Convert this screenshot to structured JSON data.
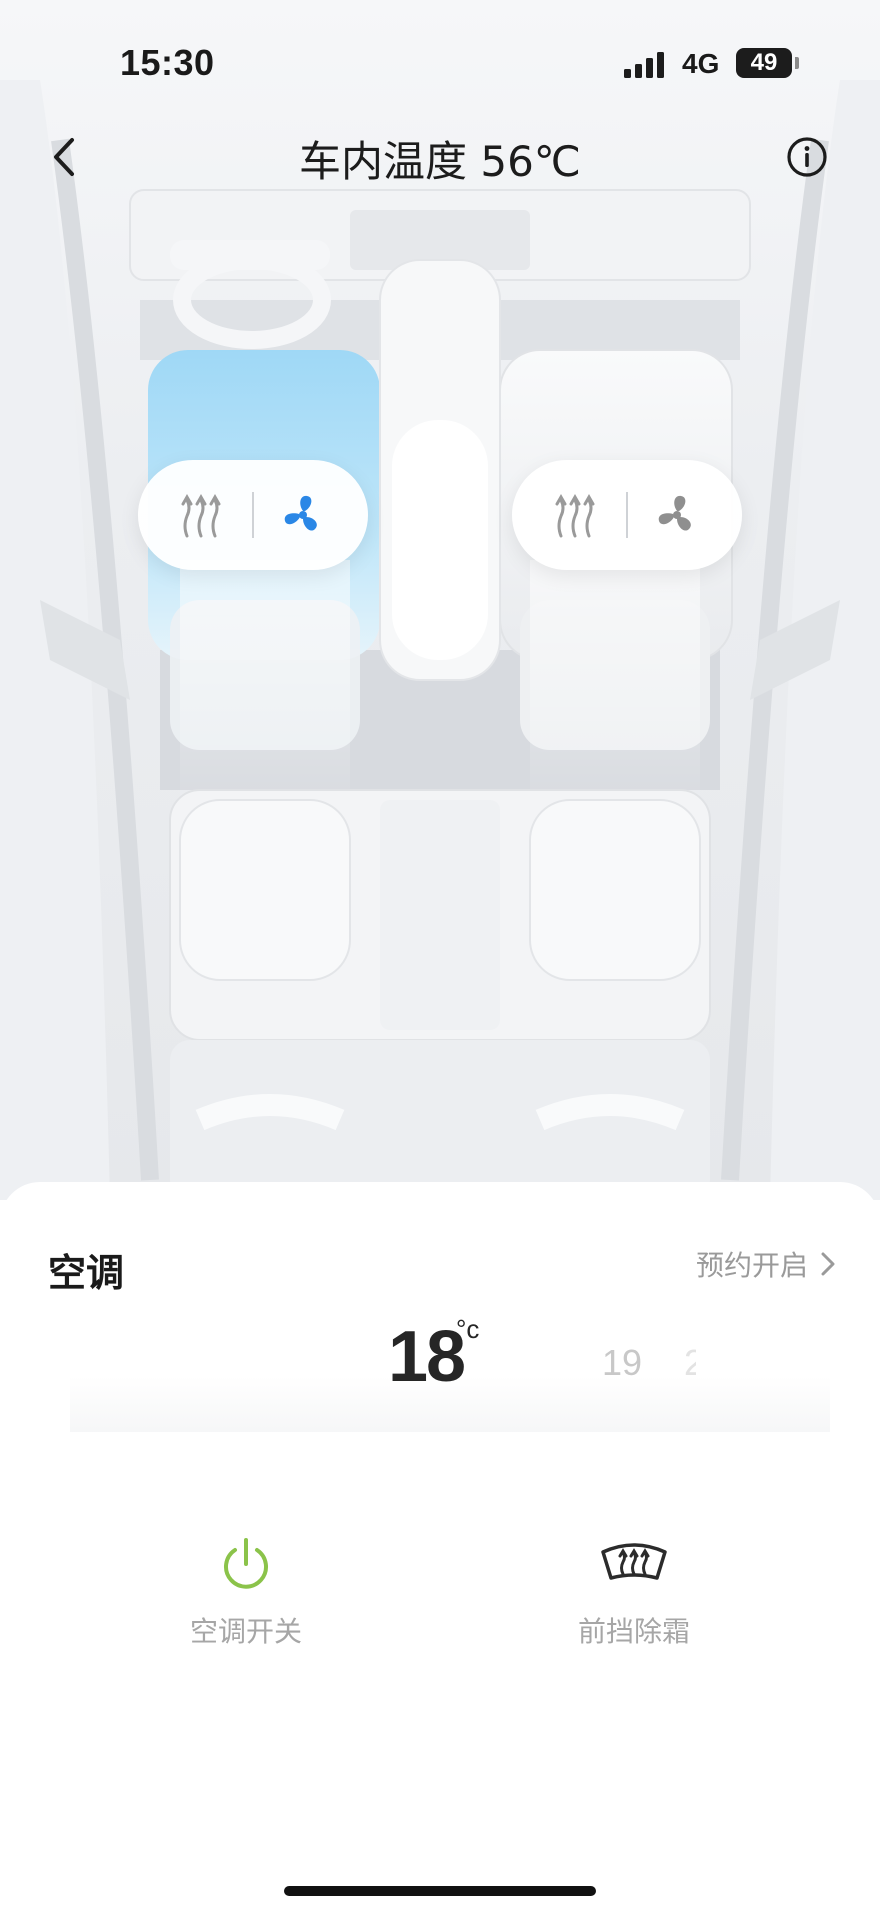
{
  "status_bar": {
    "time": "15:30",
    "network": "4G",
    "battery": "49"
  },
  "header": {
    "title": "车内温度 56℃"
  },
  "seat_controls": {
    "driver": {
      "heat_icon": "seat-heat-icon",
      "fan_icon": "seat-ventilation-icon",
      "fan_active": true,
      "active_color": "#2a87e6"
    },
    "passenger": {
      "heat_icon": "seat-heat-icon",
      "fan_icon": "seat-ventilation-icon",
      "fan_active": false,
      "inactive_color": "#8f8f8f"
    }
  },
  "climate": {
    "section_title": "空调",
    "schedule_label": "预约开启",
    "temperature": {
      "current": "18",
      "unit": "°c",
      "next": "19",
      "next2": "2"
    },
    "actions": [
      {
        "label": "空调开关",
        "icon": "power-icon",
        "color": "#8bc34a"
      },
      {
        "label": "前挡除霜",
        "icon": "front-defrost-icon",
        "color": "#2b2b2b"
      }
    ]
  }
}
